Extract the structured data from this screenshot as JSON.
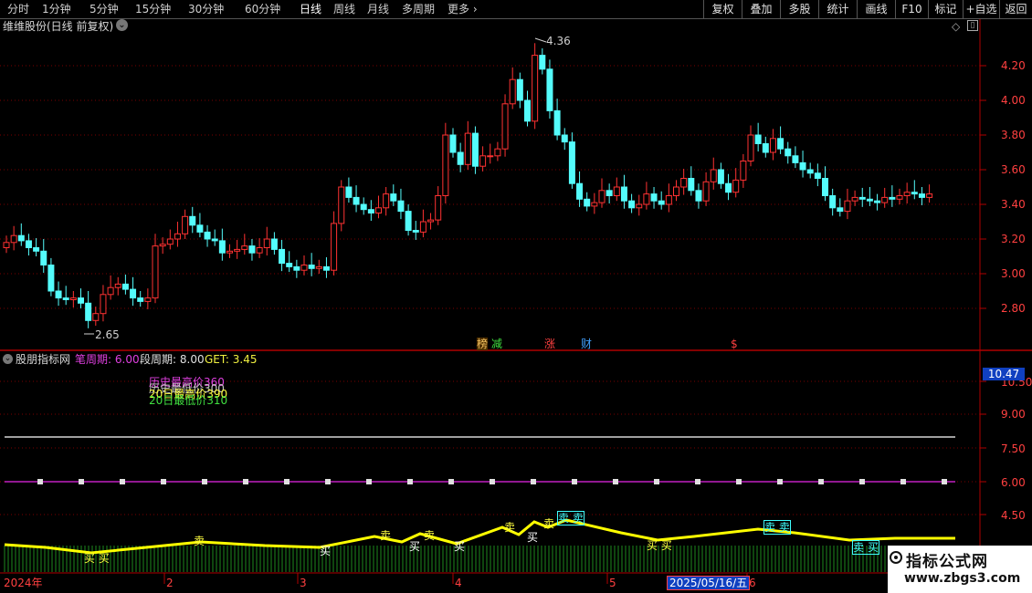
{
  "toolbar": {
    "periods": [
      "分时",
      "1分钟",
      "5分钟",
      "15分钟",
      "30分钟",
      "60分钟",
      "日线",
      "周线",
      "月线",
      "多周期",
      "更多"
    ],
    "active_period": "日线",
    "more_arrow": "›",
    "actions": [
      "复权",
      "叠加",
      "多股",
      "统计",
      "画线",
      "F10",
      "标记",
      "+自选",
      "返回"
    ]
  },
  "main_panel": {
    "title": "维维股份(日线 前复权)",
    "dropdown_icon": "chevron-down-icon",
    "price_axis": [
      "4.20",
      "4.00",
      "3.80",
      "3.60",
      "3.40",
      "3.20",
      "3.00",
      "2.80"
    ],
    "high_marker": "4.36",
    "low_marker": "2.65",
    "events": [
      {
        "text": "榜",
        "color": "#f0c060"
      },
      {
        "text": "减",
        "color": "#40e040"
      },
      {
        "text": "涨",
        "color": "#ff4040"
      },
      {
        "text": "财",
        "color": "#40a0ff"
      },
      {
        "text": "$",
        "color": "#ff4040"
      }
    ]
  },
  "indicator_panel": {
    "name": "股朋指标网",
    "params": [
      {
        "label": "笔周期:",
        "value": "6.00",
        "color": "#e040e0"
      },
      {
        "label": "段周期:",
        "value": "8.00",
        "color": "#e0e0e0"
      },
      {
        "label": "GET:",
        "value": "3.45",
        "color": "#f0f040"
      }
    ],
    "overlay_lines": [
      {
        "text": "历史最高价360",
        "color": "#e040e0"
      },
      {
        "text": "历史最低价300",
        "color": "#c8c8c8"
      },
      {
        "text": "20日最高价390",
        "color": "#ffff40"
      },
      {
        "text": "20日最低价310",
        "color": "#40e040"
      }
    ],
    "axis": [
      "10.50",
      "9.00",
      "7.50",
      "6.00",
      "4.50"
    ],
    "current_value": "10.47",
    "signals": [
      {
        "text": "买 买",
        "color": "#ffff40"
      },
      {
        "text": "卖",
        "color": "#ffff40"
      },
      {
        "text": "买",
        "color": "#ffffff"
      },
      {
        "text": "卖",
        "color": "#ffff40"
      },
      {
        "text": "买",
        "color": "#ffffff"
      },
      {
        "text": "卖",
        "color": "#ffff40"
      },
      {
        "text": "买",
        "color": "#ffffff"
      },
      {
        "text": "卖",
        "color": "#ffff40"
      },
      {
        "text": "买",
        "color": "#ffffff"
      },
      {
        "text": "卖",
        "color": "#ffff40"
      },
      {
        "text": "卖 卖",
        "color": "#40ffff"
      },
      {
        "text": "买 买",
        "color": "#ffff40"
      },
      {
        "text": "卖 卖",
        "color": "#40ffff"
      },
      {
        "text": "卖 买",
        "color": "#40ffff"
      }
    ]
  },
  "time_axis": {
    "labels": [
      "2024年",
      "2",
      "3",
      "4",
      "5",
      "6"
    ],
    "cursor_date": "2025/05/16/五"
  },
  "watermark": {
    "title": "指标公式网",
    "url": "www.zbgs3.com"
  },
  "colors": {
    "up": "#ff3232",
    "down": "#54fcfc",
    "grid": "#7a0000",
    "gann_line": "#ffff00"
  }
}
